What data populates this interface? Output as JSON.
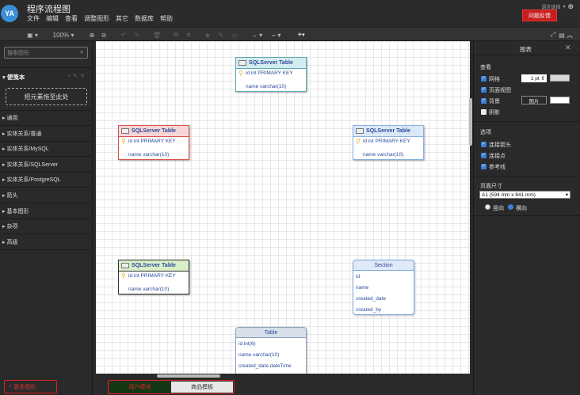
{
  "app": {
    "logo_text": "YA",
    "title": "程序流程图",
    "menu": [
      "文件",
      "编辑",
      "查看",
      "调整图形",
      "其它",
      "数据库",
      "帮助"
    ],
    "lang_label": "语言选择",
    "feedback_button": "问题反馈"
  },
  "toolbar": {
    "view_icon": "▣",
    "zoom": "100%",
    "icons": [
      "zoom-in-icon",
      "zoom-out-icon",
      "undo-icon",
      "redo-icon",
      "delete-icon",
      "to-front-icon",
      "to-back-icon",
      "fill-color-icon",
      "line-color-icon",
      "shadow-icon",
      "connection-icon",
      "waypoint-icon",
      "insert-icon",
      "fullscreen-icon",
      "collapse-icon"
    ]
  },
  "sidebar": {
    "search_placeholder": "搜索图形",
    "scratchpad_title": "便笺本",
    "dropzone_text": "把元素拖至此处",
    "libraries": [
      "通用",
      "实体关系/普通",
      "实体关系/MySQL",
      "实体关系/SQLServer",
      "实体关系/PostgreSQL",
      "箭头",
      "基本图形",
      "杂项",
      "高级"
    ],
    "more_shapes": "更多图形"
  },
  "canvas": {
    "tables": [
      {
        "title": "SQLServer Table",
        "pk": "id int PRIMARY KEY",
        "field": "name varchar(10)",
        "header_color": "#d4ecef",
        "border_color": "#5aa9b4"
      },
      {
        "title": "SQLServer Table",
        "pk": "id int PRIMARY KEY",
        "field": "name varchar(10)",
        "header_color": "#f5d5d5",
        "border_color": "#d9534f"
      },
      {
        "title": "SQLServer Table",
        "pk": "id int PRIMARY KEY",
        "field": "name varchar(10)",
        "header_color": "#dbe8f7",
        "border_color": "#8ab0dd"
      },
      {
        "title": "SQLServer Table",
        "pk": "id int PRIMARY KEY",
        "field": "name varchar(10)",
        "header_color": "#d9efc8",
        "border_color": "#333333"
      }
    ],
    "section": {
      "title": "Section",
      "rows": [
        "id",
        "name",
        "created_date",
        "created_by"
      ]
    },
    "table": {
      "title": "Table",
      "rows": [
        "id int(6)",
        "name varchar(10)",
        "created_date dateTime"
      ]
    }
  },
  "panel": {
    "title": "图表",
    "view_section": "查看",
    "grid_label": "网格",
    "grid_size": "1 pt",
    "page_view_label": "页面视图",
    "background_label": "背景",
    "image_button": "图片",
    "shadow_label": "阴影",
    "options_section": "选项",
    "connection_arrows": "连接箭头",
    "connection_points": "连接点",
    "guides": "参考线",
    "page_size_section": "页面尺寸",
    "page_size_value": "A1 (594 mm x 841 mm)",
    "portrait": "竖向",
    "landscape": "横向"
  },
  "bottom": {
    "tabs": [
      "用户模块",
      "商品模板"
    ]
  }
}
